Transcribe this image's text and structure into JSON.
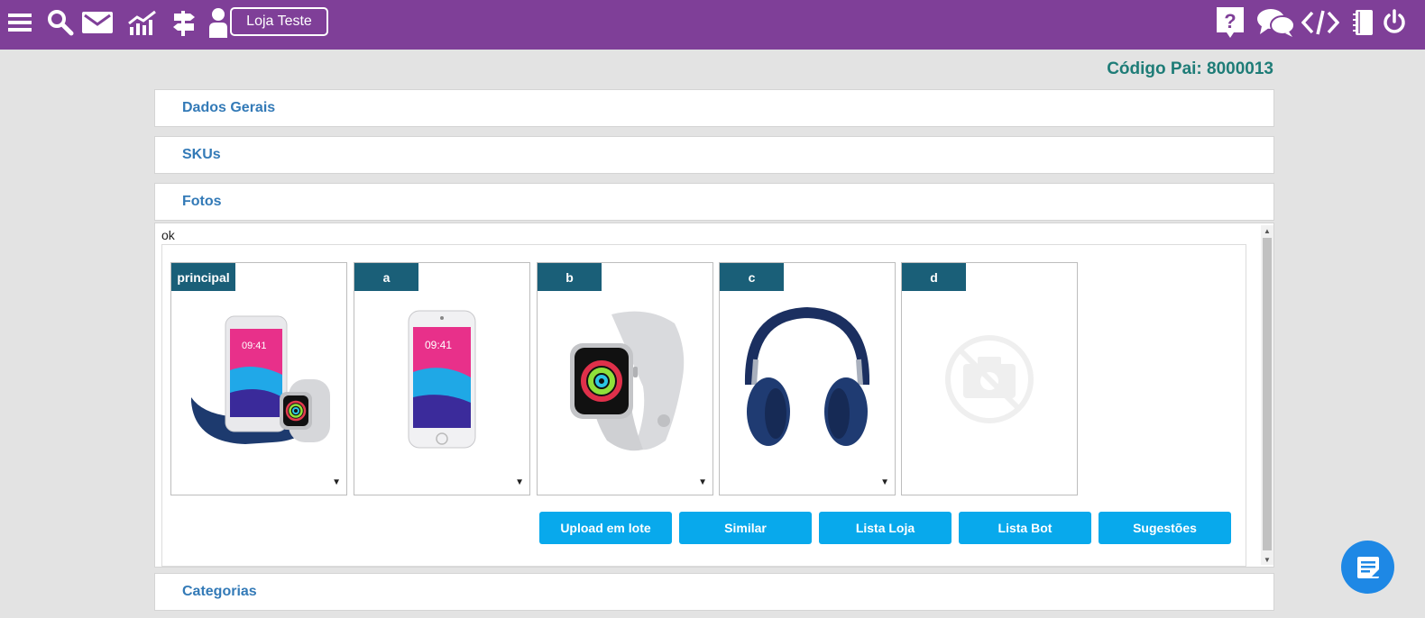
{
  "topbar": {
    "store_label": "Loja Teste",
    "icons": [
      "menu-icon",
      "search-icon",
      "mail-icon",
      "chart-icon",
      "signpost-icon",
      "user-icon",
      "help-icon",
      "chat-icon",
      "code-icon",
      "notebook-icon",
      "power-icon"
    ]
  },
  "page": {
    "codigo_pai": "Código Pai: 8000013"
  },
  "sections": {
    "dados_gerais": "Dados Gerais",
    "skus": "SKUs",
    "fotos": "Fotos",
    "categorias": "Categorias"
  },
  "fotos": {
    "status": "ok",
    "cards": [
      {
        "label": "principal",
        "image": "iphone-watch-beats-dock"
      },
      {
        "label": "a",
        "image": "iphone"
      },
      {
        "label": "b",
        "image": "apple-watch"
      },
      {
        "label": "c",
        "image": "headphones"
      },
      {
        "label": "d",
        "image": "no-photo-placeholder"
      }
    ],
    "caret": "▼",
    "buttons": [
      "Upload em lote",
      "Similar",
      "Lista Loja",
      "Lista Bot",
      "Sugestões"
    ]
  },
  "colors": {
    "topbar": "#7f3f98",
    "label_bg": "#1a5f78",
    "button": "#08a9ec",
    "link": "#337ab7",
    "codigo": "#1e7c77",
    "fab": "#1e88e5"
  }
}
